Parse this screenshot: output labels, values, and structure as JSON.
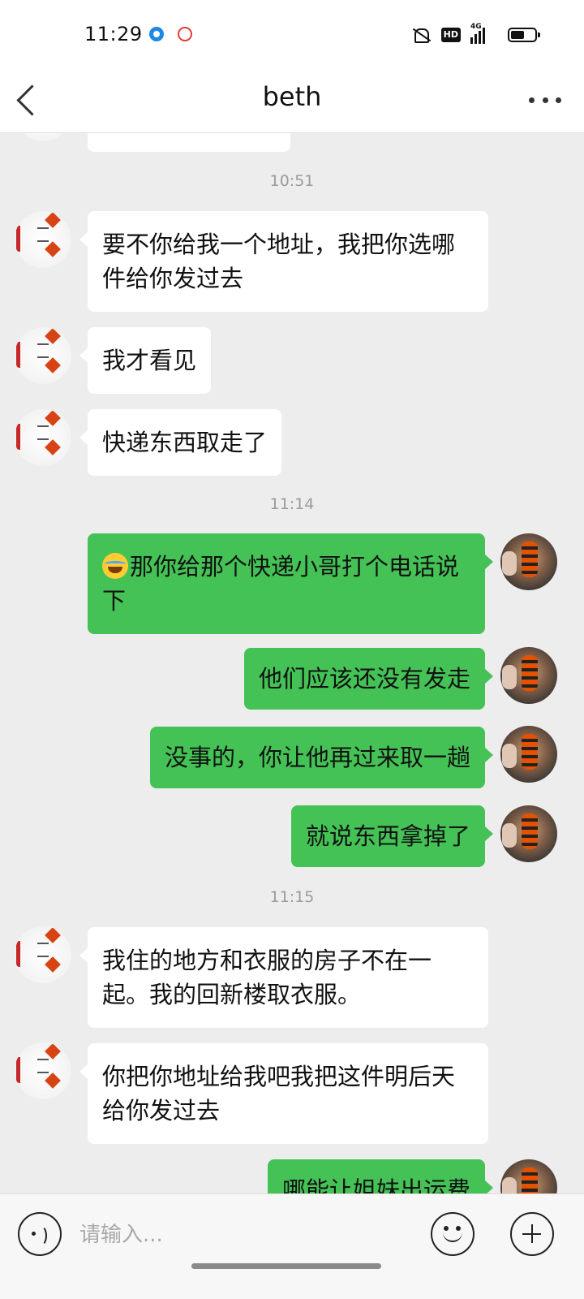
{
  "status_bar": {
    "time": "11:29",
    "icons": [
      "app-notification-icon",
      "location-app-icon",
      "mute-icon",
      "hd-icon",
      "signal-icon",
      "battery-icon"
    ],
    "hd": "HD",
    "network": "4G"
  },
  "header": {
    "title": "beth",
    "back_icon": "chevron-left-icon",
    "more_icon": "more-dots-icon"
  },
  "messages": {
    "ts_1051": "10:51",
    "m1": "要不你给我一个地址，我把你选哪件给你发过去",
    "m2": "我才看见",
    "m3": "快递东西取走了",
    "ts_1114": "11:14",
    "m4_emoji": "tears-of-joy-emoji",
    "m4": "那你给那个快递小哥打个电话说下",
    "m5": "他们应该还没有发走",
    "m6": "没事的，你让他再过来取一趟",
    "m7": "就说东西拿掉了",
    "ts_1115": "11:15",
    "m8": "我住的地方和衣服的房子不在一起。我的回新楼取衣服。",
    "m9": "你把你地址给我吧我把这件明后天给你发过去",
    "m10": "哪能让姐妹出运费"
  },
  "input_bar": {
    "placeholder": "请输入...",
    "value": "",
    "voice_icon": "voice-icon",
    "emoji_icon": "emoji-icon",
    "plus_icon": "plus-icon"
  },
  "colors": {
    "sent_bubble": "#44c256",
    "received_bubble": "#ffffff",
    "background": "#ededed"
  }
}
